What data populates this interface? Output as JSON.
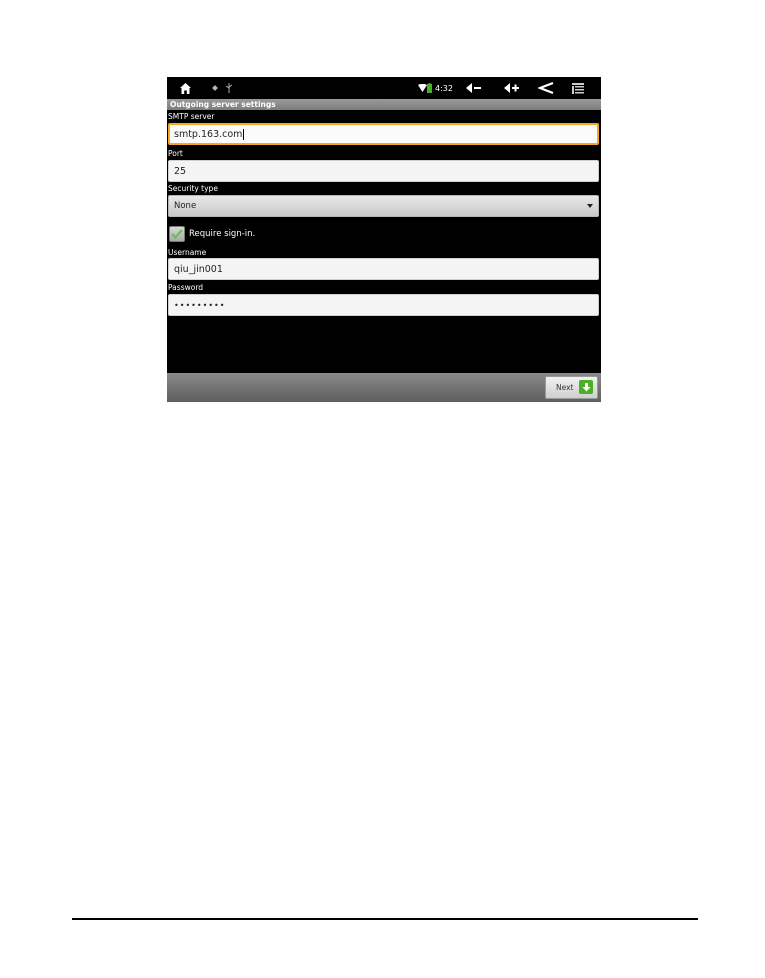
{
  "status_bar": {
    "time": "4:32",
    "icons": [
      "home-icon",
      "usb-debug-icon",
      "usb-icon",
      "wifi-icon",
      "battery-icon",
      "volume-down-icon",
      "volume-up-icon",
      "back-icon",
      "menu-icon"
    ]
  },
  "title": "Outgoing server settings",
  "smtp": {
    "label": "SMTP server",
    "value": "smtp.163.com"
  },
  "port": {
    "label": "Port",
    "value": "25"
  },
  "security": {
    "label": "Security type",
    "selected": "None"
  },
  "require_signin": {
    "label": "Require sign-in.",
    "checked": true
  },
  "username": {
    "label": "Username",
    "value": "qiu_jin001"
  },
  "password": {
    "label": "Password",
    "value": "•••••••••"
  },
  "next": {
    "label": "Next"
  },
  "colors": {
    "focus": "#f5a623",
    "check": "#6cc04a",
    "next_icon": "#4caf25"
  }
}
